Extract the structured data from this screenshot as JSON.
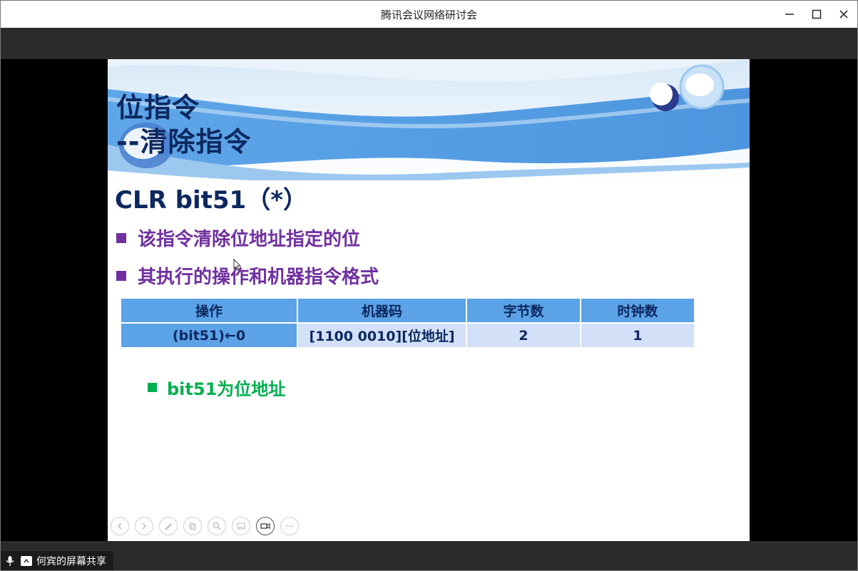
{
  "window": {
    "title": "腾讯会议网络研讨会",
    "controls": {
      "minimize": "—",
      "maximize": "☐",
      "close": "✕"
    }
  },
  "slide": {
    "title_line1": "位指令",
    "title_line2": "--清除指令",
    "heading": "CLR bit51（*）",
    "bullets": [
      "该指令清除位地址指定的位",
      "其执行的操作和机器指令格式"
    ],
    "table": {
      "headers": [
        "操作",
        "机器码",
        "字节数",
        "时钟数"
      ],
      "rows": [
        [
          "(bit51)←0",
          "[1100 0010][位地址]",
          "2",
          "1"
        ]
      ]
    },
    "sub_bullet": "bit51为位地址",
    "colors": {
      "title": "#0d2860",
      "bullet": "#7030a0",
      "sub_bullet": "#00b050",
      "table_header": "#5ba2e6",
      "table_row": "#d2e1f7"
    },
    "controls": [
      "previous-icon",
      "next-icon",
      "pen-icon",
      "pages-icon",
      "zoom-icon",
      "screen-icon",
      "camera-icon",
      "more-icon"
    ]
  },
  "share": {
    "label": "何宾的屏幕共享"
  }
}
